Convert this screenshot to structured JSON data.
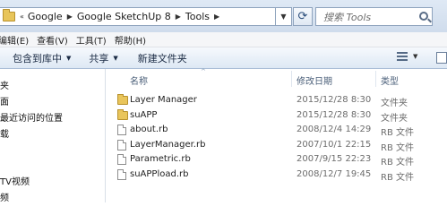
{
  "address": {
    "chevron": "«",
    "crumbs": [
      "Google",
      "Google SketchUp 8",
      "Tools"
    ],
    "separator": "▶",
    "dropdown_arrow": "▼",
    "refresh_glyph": "⟳",
    "search_placeholder": "搜索 Tools"
  },
  "menu": {
    "items": [
      "编辑(E)",
      "查看(V)",
      "工具(T)",
      "帮助(H)"
    ]
  },
  "toolbar": {
    "include_library": "包含到库中",
    "share": "共享",
    "new_folder": "新建文件夹",
    "arrow": "▼"
  },
  "nav": {
    "items": [
      "夹",
      "面",
      "最近访问的位置",
      "载",
      "TV视频",
      "频"
    ]
  },
  "columns": {
    "name": "名称",
    "date": "修改日期",
    "type": "类型",
    "sort_glyph": "^"
  },
  "files": [
    {
      "name": "Layer Manager",
      "date": "2015/12/28 8:30",
      "type": "文件夹",
      "kind": "folder"
    },
    {
      "name": "suAPP",
      "date": "2015/12/28 8:30",
      "type": "文件夹",
      "kind": "folder"
    },
    {
      "name": "about.rb",
      "date": "2008/12/4 14:29",
      "type": "RB 文件",
      "kind": "file"
    },
    {
      "name": "LayerManager.rb",
      "date": "2007/10/1 22:15",
      "type": "RB 文件",
      "kind": "file"
    },
    {
      "name": "Parametric.rb",
      "date": "2007/9/15 22:23",
      "type": "RB 文件",
      "kind": "file"
    },
    {
      "name": "suAPPload.rb",
      "date": "2008/12/7 19:45",
      "type": "RB 文件",
      "kind": "file"
    }
  ]
}
